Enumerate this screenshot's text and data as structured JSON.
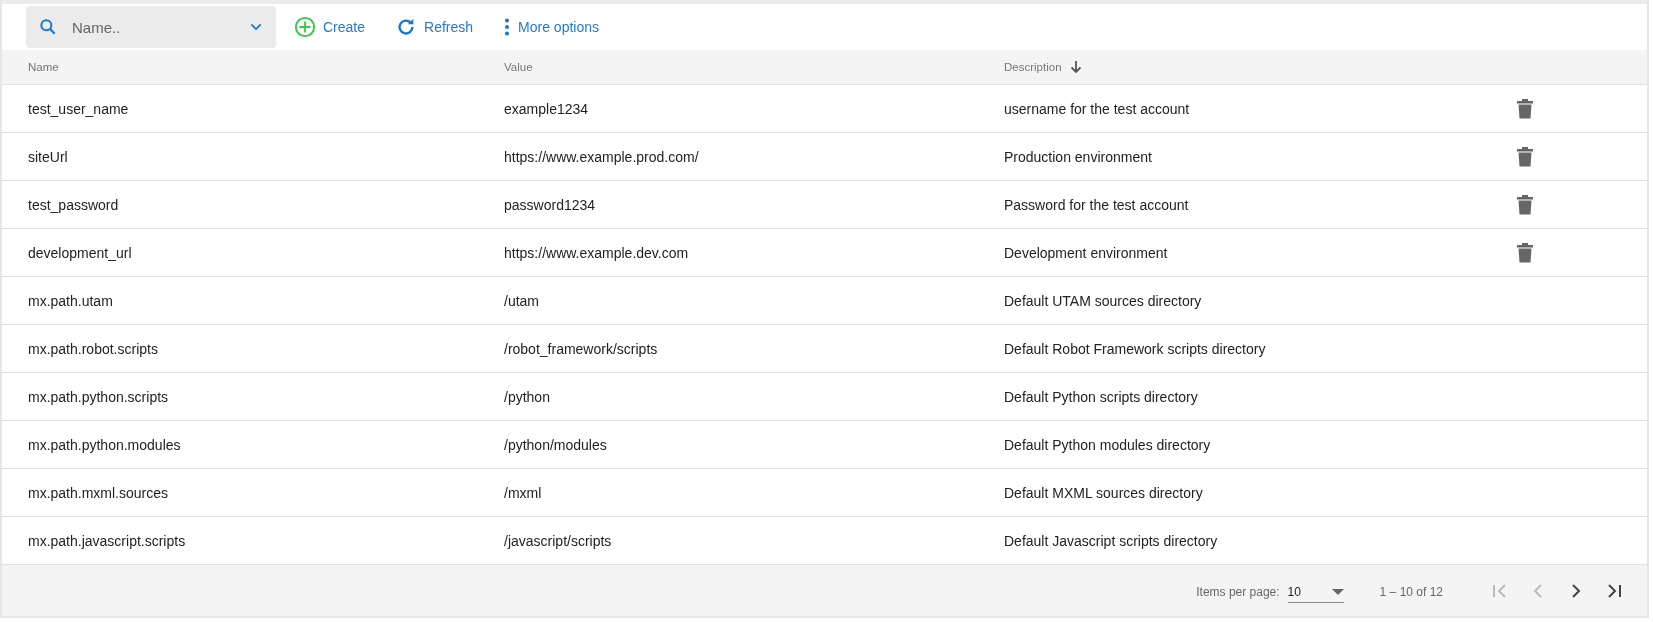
{
  "toolbar": {
    "search": {
      "placeholder": "Name.."
    },
    "actions": [
      {
        "kind": "create",
        "label": "Create"
      },
      {
        "kind": "refresh",
        "label": "Refresh"
      },
      {
        "kind": "more",
        "label": "More options"
      }
    ]
  },
  "table": {
    "columns": [
      {
        "label": "Name",
        "sorted": false
      },
      {
        "label": "Value",
        "sorted": false
      },
      {
        "label": "Description",
        "sorted": true
      }
    ],
    "rows": [
      {
        "name": "test_user_name",
        "value": "example1234",
        "description": "username for the test account",
        "deletable": true
      },
      {
        "name": "siteUrl",
        "value": "https://www.example.prod.com/",
        "description": "Production environment",
        "deletable": true
      },
      {
        "name": "test_password",
        "value": "password1234",
        "description": "Password for the test account",
        "deletable": true
      },
      {
        "name": "development_url",
        "value": "https://www.example.dev.com",
        "description": "Development environment",
        "deletable": true
      },
      {
        "name": "mx.path.utam",
        "value": "/utam",
        "description": "Default UTAM sources directory",
        "deletable": false
      },
      {
        "name": "mx.path.robot.scripts",
        "value": "/robot_framework/scripts",
        "description": "Default Robot Framework scripts directory",
        "deletable": false
      },
      {
        "name": "mx.path.python.scripts",
        "value": "/python",
        "description": "Default Python scripts directory",
        "deletable": false
      },
      {
        "name": "mx.path.python.modules",
        "value": "/python/modules",
        "description": "Default Python modules directory",
        "deletable": false
      },
      {
        "name": "mx.path.mxml.sources",
        "value": "/mxml",
        "description": "Default MXML sources directory",
        "deletable": false
      },
      {
        "name": "mx.path.javascript.scripts",
        "value": "/javascript/scripts",
        "description": "Default Javascript scripts directory",
        "deletable": false
      }
    ]
  },
  "paginator": {
    "items_per_page_label": "Items per page:",
    "page_size": "10",
    "range": "1 – 10 of 12",
    "first_disabled": true,
    "previous_disabled": true,
    "next_disabled": false,
    "last_disabled": false
  }
}
